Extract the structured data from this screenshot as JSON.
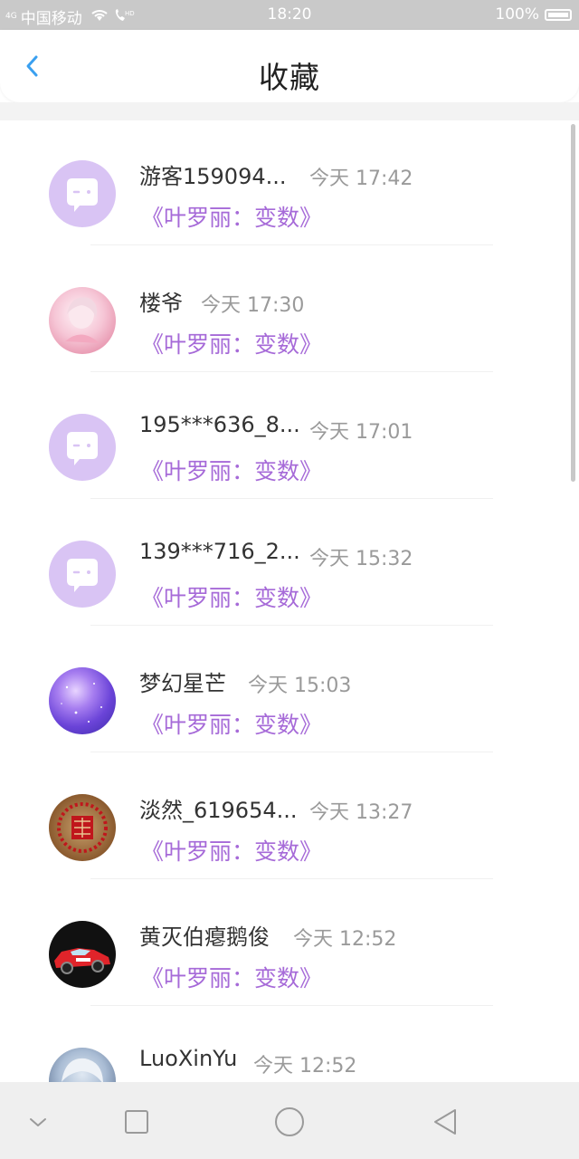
{
  "status_bar": {
    "signal": "4G",
    "carrier": "中国移动",
    "time": "18:20",
    "battery": "100%"
  },
  "header": {
    "title": "收藏",
    "back_icon": "chevron-left-icon"
  },
  "colors": {
    "accent_purple": "#a66ad8",
    "back_blue": "#3aa0f0",
    "default_avatar": "#d9c4f4"
  },
  "favorites": [
    {
      "name": "游客159094...",
      "time": "今天 17:42",
      "book": "《叶罗丽：变数》",
      "avatar": "default-avatar-icon"
    },
    {
      "name": "楼爷",
      "time": "今天 17:30",
      "book": "《叶罗丽：变数》",
      "avatar": "anime-girl-avatar"
    },
    {
      "name": "195***636_8...",
      "time": "今天 17:01",
      "book": "《叶罗丽：变数》",
      "avatar": "default-avatar-icon"
    },
    {
      "name": "139***716_2...",
      "time": "今天 15:32",
      "book": "《叶罗丽：变数》",
      "avatar": "default-avatar-icon"
    },
    {
      "name": "梦幻星芒",
      "time": "今天 15:03",
      "book": "《叶罗丽：变数》",
      "avatar": "galaxy-avatar"
    },
    {
      "name": "淡然_619654...",
      "time": "今天 13:27",
      "book": "《叶罗丽：变数》",
      "avatar": "paper-cut-avatar"
    },
    {
      "name": "黄灭伯瘪鹅俊",
      "time": "今天 12:52",
      "book": "《叶罗丽：变数》",
      "avatar": "race-car-avatar"
    },
    {
      "name": "LuoXinYu",
      "time": "今天 12:52",
      "book": "",
      "avatar": "anime-boy-avatar"
    }
  ],
  "nav_bar": {
    "buttons": [
      "chevron-down-icon",
      "square-icon",
      "circle-icon",
      "triangle-back-icon"
    ]
  }
}
